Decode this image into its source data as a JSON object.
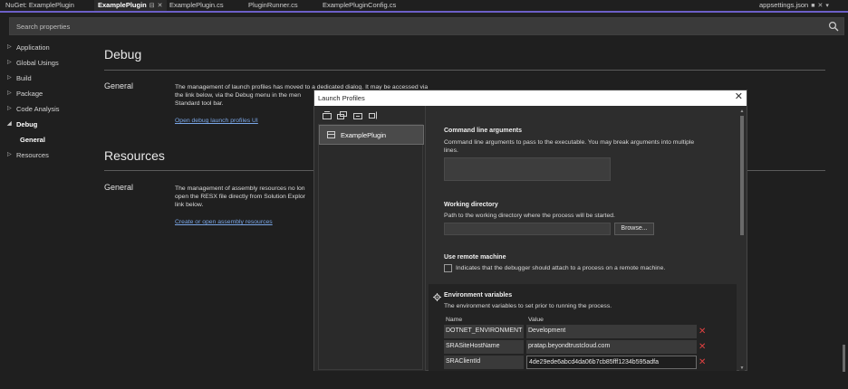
{
  "tabs": [
    {
      "label": "NuGet: ExamplePlugin"
    },
    {
      "label": "ExamplePlugin",
      "pin": "⊟",
      "close": "✕"
    },
    {
      "label": "ExamplePlugin.cs"
    },
    {
      "label": "PluginRunner.cs"
    },
    {
      "label": "ExamplePluginConfig.cs"
    },
    {
      "label": "appsettings.json",
      "pin": "■",
      "close": "✕",
      "dropdown": "▾"
    }
  ],
  "search": {
    "placeholder": "Search properties"
  },
  "nav": [
    {
      "label": "Application",
      "expander": "▷"
    },
    {
      "label": "Global Usings",
      "expander": "▷"
    },
    {
      "label": "Build",
      "expander": "▷"
    },
    {
      "label": "Package",
      "expander": "▷"
    },
    {
      "label": "Code Analysis",
      "expander": "▷"
    },
    {
      "label": "Debug",
      "expander": "◢"
    },
    {
      "label": "General"
    },
    {
      "label": "Resources",
      "expander": "▷"
    }
  ],
  "debug": {
    "title": "Debug",
    "general_label": "General",
    "desc_lines": [
      "The management of launch profiles has moved to a dedicated dialog. It may be accessed via",
      "the link below, via the Debug menu in the men",
      "Standard tool bar."
    ],
    "link": "Open debug launch profiles UI"
  },
  "resources": {
    "title": "Resources",
    "general_label": "General",
    "desc_lines": [
      "The management of assembly resources no lon",
      "open the RESX file directly from Solution Explor",
      "link below."
    ],
    "link": "Create or open assembly resources"
  },
  "dialog": {
    "title": "Launch Profiles",
    "close": "✕",
    "toolbar_icons": [
      "new-profile-icon",
      "duplicate-profile-icon",
      "delete-profile-icon",
      "rename-profile-icon"
    ],
    "profiles": [
      {
        "name": "ExamplePlugin"
      }
    ],
    "cmd_args": {
      "title": "Command line arguments",
      "desc_lines": [
        "Command line arguments to pass to the executable. You may break arguments into multiple",
        "lines."
      ],
      "value": ""
    },
    "working_dir": {
      "title": "Working directory",
      "desc": "Path to the working directory where the process will be started.",
      "value": "",
      "browse": "Browse..."
    },
    "remote": {
      "title": "Use remote machine",
      "checkbox_label": "Indicates that the debugger should attach to a process on a remote machine.",
      "checked": false
    },
    "env": {
      "title": "Environment variables",
      "desc": "The environment variables to set prior to running the process.",
      "col_name": "Name",
      "col_value": "Value",
      "rows": [
        {
          "name": "DOTNET_ENVIRONMENT",
          "value": "Development"
        },
        {
          "name": "SRASiteHostName",
          "value": "pratap.beyondtrustcloud.com"
        },
        {
          "name": "SRAClientId",
          "value": "4de29ede6abcd4da06b7cb85fff1234b595adfa"
        }
      ],
      "delete_glyph": "✕",
      "delete_color": "#e04141"
    }
  },
  "colors": {
    "accent": "#6c5fc7",
    "link": "#7aa6e6"
  }
}
